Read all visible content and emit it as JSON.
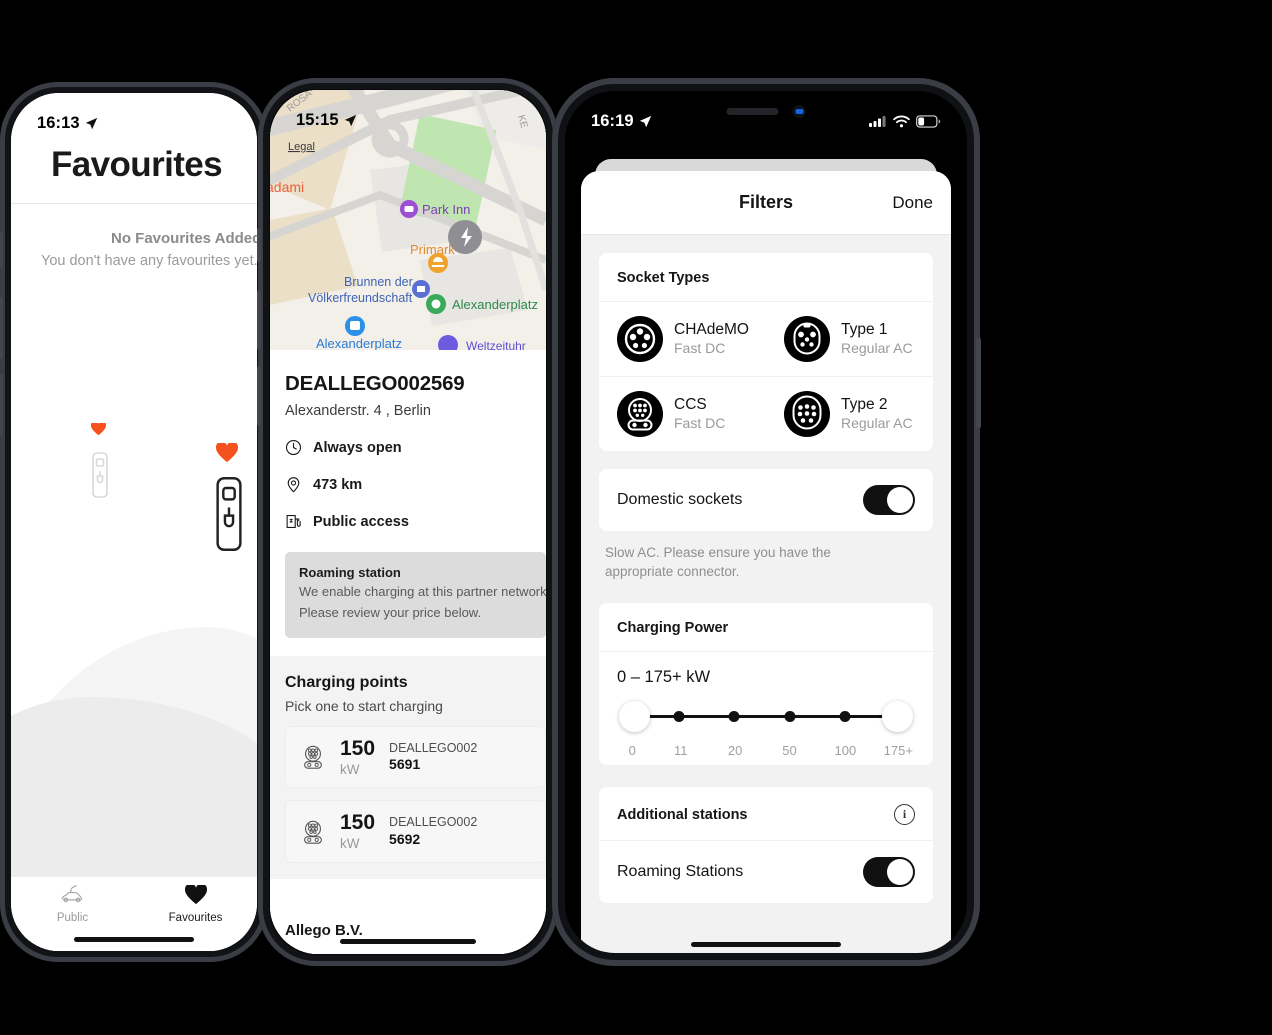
{
  "phone1": {
    "status": {
      "time": "16:13",
      "location_icon": "location-arrow-icon"
    },
    "title": "Favourites",
    "empty": {
      "heading": "No Favourites Added",
      "body": "You don't have any favourites yet. Tap the heart on a station!"
    },
    "tabs": [
      {
        "label": "Public",
        "icon": "car-charging-icon",
        "active": false
      },
      {
        "label": "Favourites",
        "icon": "heart-icon",
        "active": true
      }
    ]
  },
  "phone2": {
    "status": {
      "time": "15:15",
      "location_icon": "location-arrow-icon"
    },
    "map": {
      "legal_link": "Legal",
      "labels": [
        "adami",
        "Park Inn",
        "Primark",
        "Brunnen der",
        "Völkerfreundschaft",
        "Alexanderplatz",
        "Alexanderplatz",
        "ROSA"
      ]
    },
    "station": {
      "name": "DEALLEGO002569",
      "address": "Alexanderstr. 4  , Berlin",
      "facts": [
        {
          "icon": "clock-icon",
          "text": "Always open"
        },
        {
          "icon": "map-pin-icon",
          "text": "473 km"
        },
        {
          "icon": "charging-station-icon",
          "text": "Public access"
        }
      ],
      "roaming": {
        "title": "Roaming station",
        "body_line1": "We enable charging at this partner network.",
        "body_line2": "Please review your price below."
      },
      "charging_points": {
        "title": "Charging points",
        "subtitle": "Pick one to start charging",
        "items": [
          {
            "icon": "ccs-socket-icon",
            "power": "150",
            "unit": "kW",
            "id_prefix": "DEALLEGO002",
            "id_suffix": "5691"
          },
          {
            "icon": "ccs-socket-icon",
            "power": "150",
            "unit": "kW",
            "id_prefix": "DEALLEGO002",
            "id_suffix": "5692"
          }
        ]
      },
      "operator": "Allego B.V."
    }
  },
  "phone3": {
    "status": {
      "time": "16:19",
      "location_icon": "location-arrow-icon",
      "cellular_icon": "cellular-bars-icon",
      "wifi_icon": "wifi-icon",
      "battery_icon": "battery-low-icon"
    },
    "nav": {
      "title": "Filters",
      "done_label": "Done"
    },
    "socket_types": {
      "header": "Socket Types",
      "items": [
        {
          "icon": "chademo-socket-icon",
          "name": "CHAdeMO",
          "sub": "Fast DC"
        },
        {
          "icon": "type1-socket-icon",
          "name": "Type 1",
          "sub": "Regular AC"
        },
        {
          "icon": "ccs-socket-icon",
          "name": "CCS",
          "sub": "Fast DC"
        },
        {
          "icon": "type2-socket-icon",
          "name": "Type 2",
          "sub": "Regular AC"
        }
      ]
    },
    "domestic": {
      "label": "Domestic sockets",
      "enabled": true,
      "hint_line1": "Slow AC. Please ensure you have the",
      "hint_line2": "appropriate connector."
    },
    "charging_power": {
      "header": "Charging Power",
      "value_label": "0 – 175+ kW",
      "ticks": [
        "0",
        "11",
        "20",
        "50",
        "100",
        "175+"
      ],
      "min_handle": "0",
      "max_handle": "175+"
    },
    "additional": {
      "header": "Additional stations",
      "info_icon": "info-icon",
      "roaming_label": "Roaming Stations",
      "roaming_enabled": true
    }
  },
  "colors": {
    "accent": "#f4511e",
    "ink": "#141414",
    "muted": "#9b9b9b",
    "sheet_bg": "#f2f2f2"
  }
}
